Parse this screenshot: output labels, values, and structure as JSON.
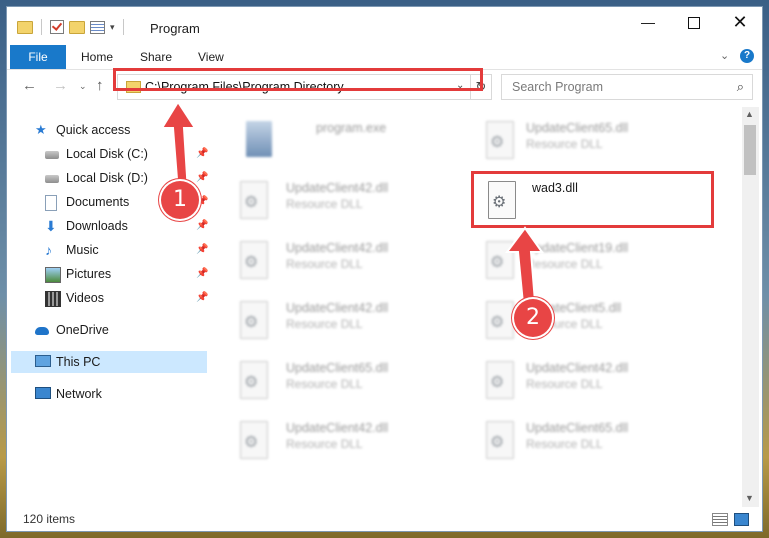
{
  "window": {
    "title": "Program",
    "controls": {
      "minimize": "—",
      "maximize": "",
      "close": "✕"
    }
  },
  "ribbon": {
    "tabs": [
      "File",
      "Home",
      "Share",
      "View"
    ],
    "collapse": "⌄",
    "help": "?"
  },
  "nav": {
    "back": "←",
    "forward": "→",
    "recent": "⌄",
    "up": "↑",
    "address": "C:\\Program Files\\Program Directory",
    "address_dropdown": "⌄",
    "refresh": "↻",
    "search_placeholder": "Search Program",
    "search_icon": "⌕"
  },
  "sidebar": {
    "items": [
      {
        "label": "Quick access",
        "icon": "star-icon",
        "pinned": false
      },
      {
        "label": "Local Disk (C:)",
        "icon": "disk-icon",
        "pinned": true
      },
      {
        "label": "Local Disk (D:)",
        "icon": "disk-icon",
        "pinned": true
      },
      {
        "label": "Documents",
        "icon": "documents-icon",
        "pinned": true
      },
      {
        "label": "Downloads",
        "icon": "download-icon",
        "pinned": true
      },
      {
        "label": "Music",
        "icon": "music-icon",
        "pinned": true
      },
      {
        "label": "Pictures",
        "icon": "pictures-icon",
        "pinned": true
      },
      {
        "label": "Videos",
        "icon": "videos-icon",
        "pinned": true
      },
      {
        "label": "OneDrive",
        "icon": "cloud-icon",
        "pinned": false
      },
      {
        "label": "This PC",
        "icon": "computer-icon",
        "pinned": false,
        "selected": true
      },
      {
        "label": "Network",
        "icon": "network-icon",
        "pinned": false
      }
    ],
    "pin_glyph": "📌"
  },
  "files": [
    {
      "name": "program.exe",
      "type": "",
      "blurred": true
    },
    {
      "name": "UpdateClient65.dll",
      "type": "Resource DLL",
      "blurred": true
    },
    {
      "name": "UpdateClient42.dll",
      "type": "Resource DLL",
      "blurred": true
    },
    {
      "name": "wad3.dll",
      "type": "",
      "blurred": false
    },
    {
      "name": "UpdateClient42.dll",
      "type": "Resource DLL",
      "blurred": true
    },
    {
      "name": "UpdateClient19.dll",
      "type": "Resource DLL",
      "blurred": true
    },
    {
      "name": "UpdateClient42.dll",
      "type": "Resource DLL",
      "blurred": true
    },
    {
      "name": "UpdateClient5.dll",
      "type": "Resource DLL",
      "blurred": true
    },
    {
      "name": "UpdateClient65.dll",
      "type": "Resource DLL",
      "blurred": true
    },
    {
      "name": "UpdateClient42.dll",
      "type": "Resource DLL",
      "blurred": true
    },
    {
      "name": "UpdateClient42.dll",
      "type": "Resource DLL",
      "blurred": true
    },
    {
      "name": "UpdateClient65.dll",
      "type": "Resource DLL",
      "blurred": true
    }
  ],
  "scroll": {
    "up": "▲",
    "down": "▼"
  },
  "status": {
    "items_count": "120 items"
  },
  "annotations": {
    "step1": "1",
    "step2": "2",
    "color": "#e84545"
  }
}
